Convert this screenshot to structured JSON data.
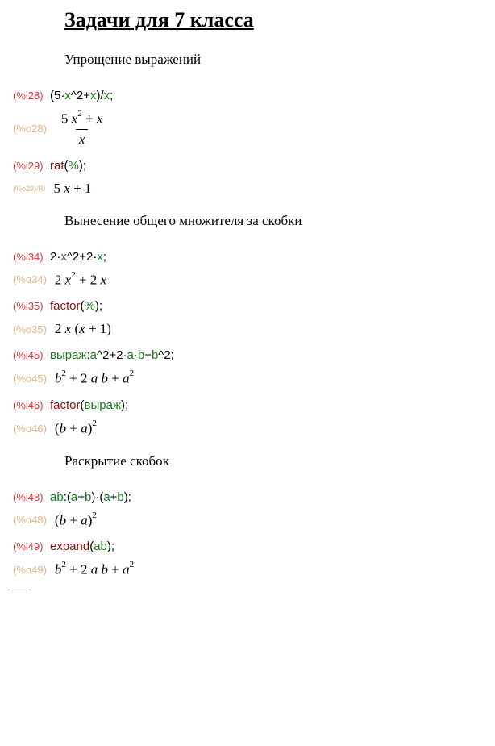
{
  "title": "Задачи для 7 класса",
  "sections": {
    "s1": "Упрощение выражений",
    "s2": "Вынесение общего множителя за скобки",
    "s3": "Раскрытие скобок"
  },
  "labels": {
    "i28": "(%i28)",
    "o28": "(%o28)",
    "i29": "(%i29)",
    "o29": "(%o29)/R/",
    "i34": "(%i34)",
    "o34": "(%o34)",
    "i35": "(%i35)",
    "o35": "(%o35)",
    "i45": "(%i45)",
    "o45": "(%o45)",
    "i46": "(%i46)",
    "o46": "(%o46)",
    "i48": "(%i48)",
    "o48": "(%o48)",
    "i49": "(%i49)",
    "o49": "(%o49)"
  },
  "inputs": {
    "i28": {
      "op1": "(",
      "n5": "5",
      "dot1": "·",
      "x1": "x",
      "caret1": "^",
      "n2a": "2",
      "plus1": "+",
      "x2": "x",
      "cp1": ")",
      "slash": "/",
      "x3": "x",
      "semi": ";"
    },
    "i29": {
      "fn": "rat",
      "op": "(",
      "var": "%",
      "cp": ")",
      "semi": ";"
    },
    "i34": {
      "n2a": "2",
      "dot1": "·",
      "x1": "x",
      "caret": "^",
      "n2b": "2",
      "plus": "+",
      "n2c": "2",
      "dot2": "·",
      "x2": "x",
      "semi": ";"
    },
    "i35": {
      "fn": "factor",
      "op": "(",
      "var": "%",
      "cp": ")",
      "semi": ";"
    },
    "i45": {
      "name": "выраж",
      "colon": ":",
      "a1": "a",
      "caret1": "^",
      "n2a": "2",
      "plus1": "+",
      "n2b": "2",
      "dot1": "·",
      "a2": "a",
      "dot2": "·",
      "b1": "b",
      "plus2": "+",
      "b2": "b",
      "caret2": "^",
      "n2c": "2",
      "semi": ";"
    },
    "i46": {
      "fn": "factor",
      "op": "(",
      "var": "выраж",
      "cp": ")",
      "semi": ";"
    },
    "i48": {
      "name": "ab",
      "colon": ":",
      "op1": "(",
      "a1": "a",
      "plus1": "+",
      "b1": "b",
      "cp1": ")",
      "dot": "·",
      "op2": "(",
      "a2": "a",
      "plus2": "+",
      "b2": "b",
      "cp2": ")",
      "semi": ";"
    },
    "i49": {
      "fn": "expand",
      "op": "(",
      "var": "ab",
      "cp": ")",
      "semi": ";"
    }
  },
  "outputs": {
    "o28": {
      "numL": "5 ",
      "numVar": "x",
      "numSup": "2",
      "numPlus": " + ",
      "numVar2": "x",
      "den": "x"
    },
    "o29": {
      "t1": "5 ",
      "v1": "x",
      "t2": " + 1"
    },
    "o34": {
      "t1": "2 ",
      "v1": "x",
      "sup1": "2",
      "t2": " + 2 ",
      "v2": "x"
    },
    "o35": {
      "t1": "2 ",
      "v1": "x",
      "t2": " (",
      "v2": "x",
      "t3": " + 1)"
    },
    "o45": {
      "v1": "b",
      "sup1": "2",
      "t1": " + 2 ",
      "v2": "a b",
      "t2": " + ",
      "v3": "a",
      "sup2": "2"
    },
    "o46": {
      "t1": "(",
      "v1": "b",
      "t2": " + ",
      "v2": "a",
      "t3": ")",
      "sup": "2"
    },
    "o48": {
      "t1": "(",
      "v1": "b",
      "t2": " + ",
      "v2": "a",
      "t3": ")",
      "sup": "2"
    },
    "o49": {
      "v1": "b",
      "sup1": "2",
      "t1": " + 2 ",
      "v2": "a b",
      "t2": " + ",
      "v3": "a",
      "sup2": "2"
    }
  }
}
